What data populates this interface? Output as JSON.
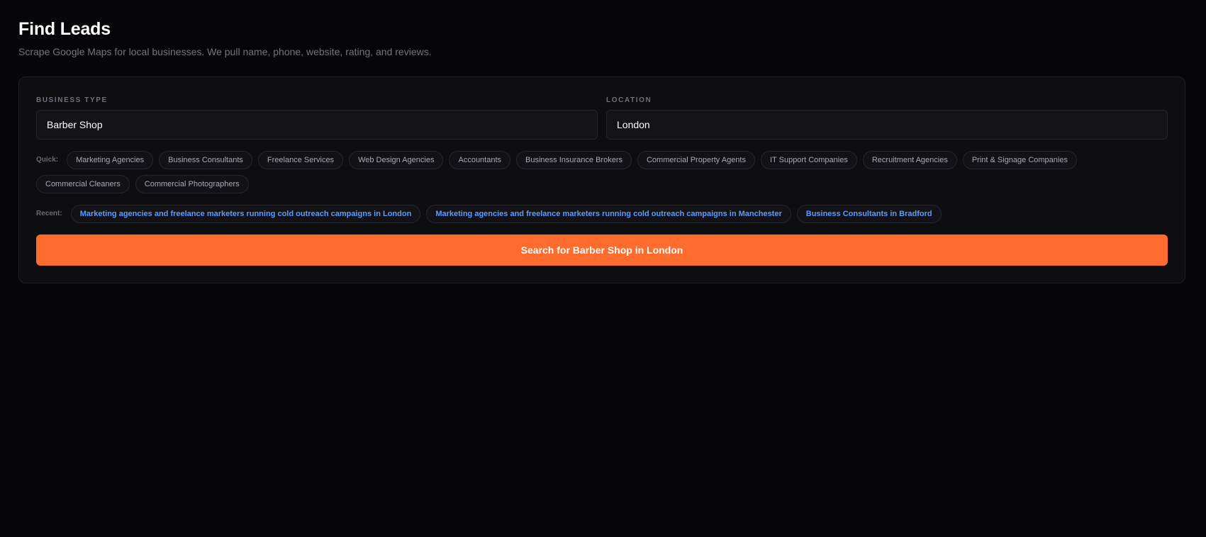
{
  "header": {
    "title": "Find Leads",
    "subtitle": "Scrape Google Maps for local businesses. We pull name, phone, website, rating, and reviews."
  },
  "form": {
    "business_type_label": "BUSINESS TYPE",
    "business_type_value": "Barber Shop",
    "location_label": "LOCATION",
    "location_value": "London"
  },
  "quick": {
    "label": "Quick:",
    "items": [
      "Marketing Agencies",
      "Business Consultants",
      "Freelance Services",
      "Web Design Agencies",
      "Accountants",
      "Business Insurance Brokers",
      "Commercial Property Agents",
      "IT Support Companies",
      "Recruitment Agencies",
      "Print & Signage Companies",
      "Commercial Cleaners",
      "Commercial Photographers"
    ]
  },
  "recent": {
    "label": "Recent:",
    "items": [
      "Marketing agencies and freelance marketers running cold outreach campaigns in London",
      "Marketing agencies and freelance marketers running cold outreach campaigns in Manchester",
      "Business Consultants in Bradford"
    ]
  },
  "search_button": {
    "label": "Search for Barber Shop in London"
  },
  "colors": {
    "background": "#060608",
    "card": "#0e0e11",
    "accent": "#ff6b2c",
    "recent_link": "#5a9cff"
  }
}
